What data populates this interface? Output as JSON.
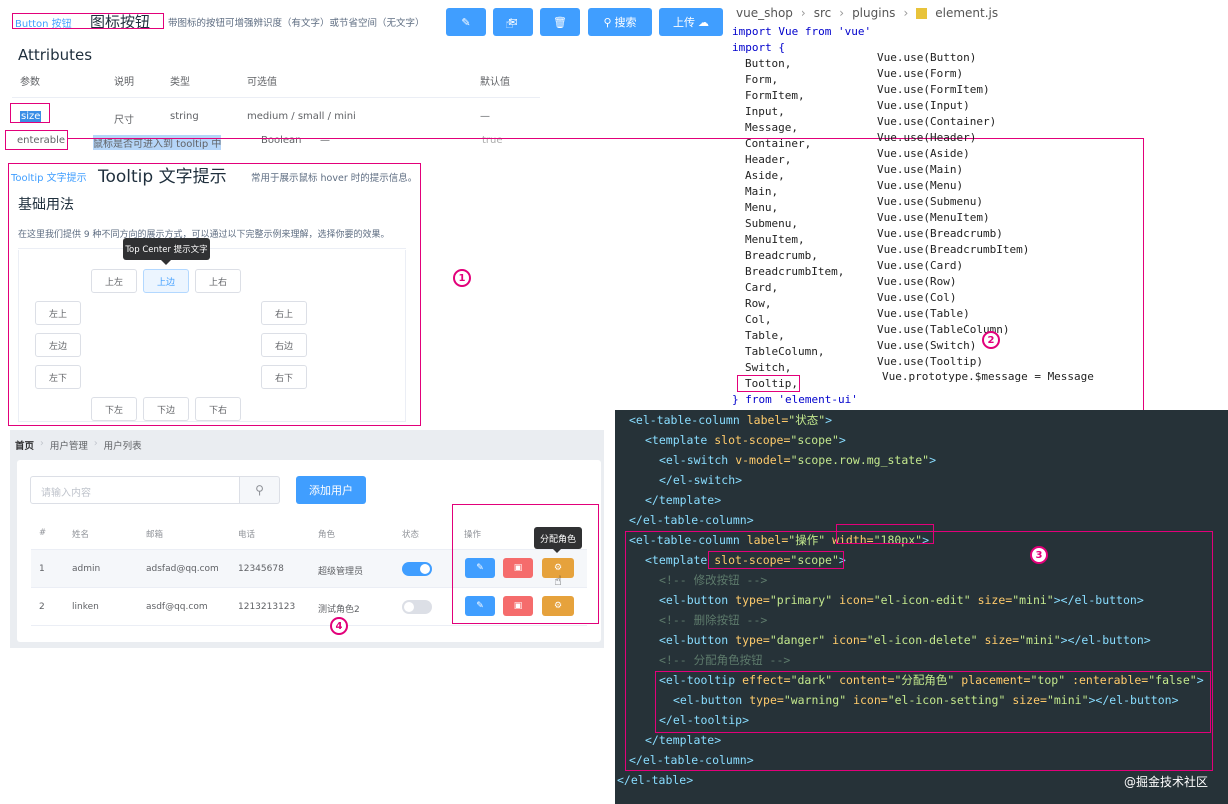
{
  "button_doc": {
    "link": "Button 按钮",
    "title": "图标按钮",
    "desc": "带图标的按钮可增强辨识度（有文字）或节省空间（无文字）",
    "search_label": "搜索",
    "upload_label": "上传"
  },
  "attributes": {
    "title": "Attributes",
    "headers": [
      "参数",
      "说明",
      "类型",
      "可选值",
      "默认值"
    ],
    "rows": [
      [
        "size",
        "尺寸",
        "string",
        "medium / small / mini",
        "—"
      ],
      [
        "enterable",
        "鼠标是否可进入到 tooltip 中",
        "Boolean",
        "—",
        "true"
      ]
    ]
  },
  "tooltip_doc": {
    "link": "Tooltip 文字提示",
    "title": "Tooltip 文字提示",
    "desc": "常用于展示鼠标 hover 时的提示信息。",
    "section": "基础用法",
    "intro": "在这里我们提供 9 种不同方向的展示方式，可以通过以下完整示例来理解，选择你要的效果。",
    "popup": "Top Center 提示文字",
    "top": [
      "上左",
      "上边",
      "上右"
    ],
    "left": [
      "左上",
      "左边",
      "左下"
    ],
    "right": [
      "右上",
      "右边",
      "右下"
    ],
    "bottom": [
      "下左",
      "下边",
      "下右"
    ]
  },
  "users": {
    "breadcrumb": [
      "首页",
      "用户管理",
      "用户列表"
    ],
    "search_placeholder": "请输入内容",
    "add_label": "添加用户",
    "headers": [
      "#",
      "姓名",
      "邮箱",
      "电话",
      "角色",
      "状态",
      "操作"
    ],
    "rows": [
      {
        "idx": "1",
        "name": "admin",
        "email": "adsfad@qq.com",
        "phone": "12345678",
        "role": "超级管理员",
        "state_on": true
      },
      {
        "idx": "2",
        "name": "linken",
        "email": "asdf@qq.com",
        "phone": "1213213123",
        "role": "测试角色2",
        "state_on": false
      }
    ],
    "tooltip": "分配角色"
  },
  "editor": {
    "breadcrumb": [
      "vue_shop",
      "src",
      "plugins",
      "element.js"
    ],
    "import_line": "import Vue from 'vue'",
    "import_open": "import {",
    "imports": [
      "Button,",
      "Form,",
      "FormItem,",
      "Input,",
      "Message,",
      "Container,",
      "Header,",
      "Aside,",
      "Main,",
      "Menu,",
      "Submenu,",
      "MenuItem,",
      "Breadcrumb,",
      "BreadcrumbItem,",
      "Card,",
      "Row,",
      "Col,",
      "Table,",
      "TableColumn,",
      "Switch,",
      "Tooltip,"
    ],
    "from_line": "} from 'element-ui'",
    "uses": [
      "Vue.use(Button)",
      "Vue.use(Form)",
      "Vue.use(FormItem)",
      "Vue.use(Input)",
      "Vue.use(Container)",
      "Vue.use(Header)",
      "Vue.use(Aside)",
      "Vue.use(Main)",
      "Vue.use(Menu)",
      "Vue.use(Submenu)",
      "Vue.use(MenuItem)",
      "Vue.use(Breadcrumb)",
      "Vue.use(BreadcrumbItem)",
      "Vue.use(Card)",
      "Vue.use(Row)",
      "Vue.use(Col)",
      "Vue.use(Table)",
      "Vue.use(TableColumn)",
      "Vue.use(Switch)",
      "Vue.use(Tooltip)"
    ],
    "prototype_line": "Vue.prototype.$message = Message"
  },
  "markers": [
    "1",
    "2",
    "3",
    "4"
  ],
  "watermark": "@掘金技术社区"
}
